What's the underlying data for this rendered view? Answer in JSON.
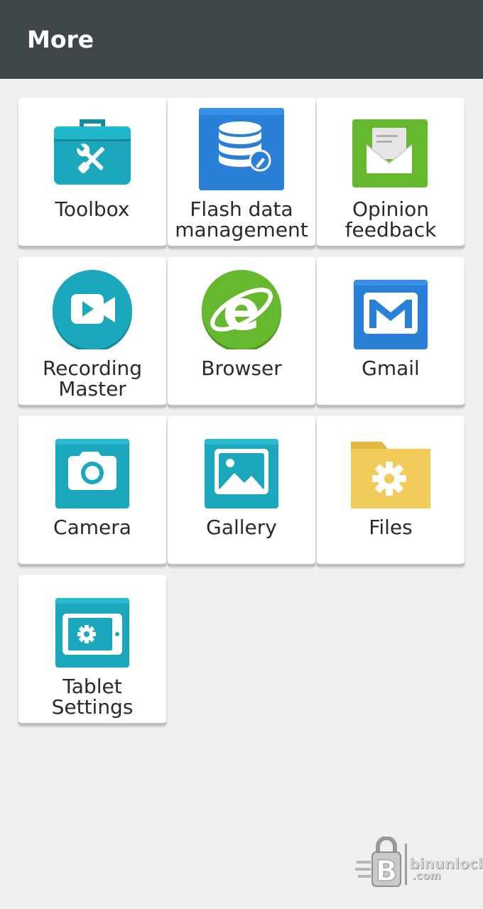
{
  "header": {
    "title": "More"
  },
  "apps": [
    {
      "id": "toolbox",
      "icon": "toolbox-icon",
      "line1": "Toolbox",
      "line2": ""
    },
    {
      "id": "flash-data-management",
      "icon": "database-icon",
      "line1": "Flash data",
      "line2": "management"
    },
    {
      "id": "opinion-feedback",
      "icon": "envelope-icon",
      "line1": "Opinion",
      "line2": "feedback"
    },
    {
      "id": "recording-master",
      "icon": "video-camera-icon",
      "line1": "Recording",
      "line2": "Master"
    },
    {
      "id": "browser",
      "icon": "browser-e-icon",
      "line1": "Browser",
      "line2": ""
    },
    {
      "id": "gmail",
      "icon": "gmail-icon",
      "line1": "Gmail",
      "line2": ""
    },
    {
      "id": "camera",
      "icon": "camera-icon",
      "line1": "Camera",
      "line2": ""
    },
    {
      "id": "gallery",
      "icon": "gallery-icon",
      "line1": "Gallery",
      "line2": ""
    },
    {
      "id": "files",
      "icon": "folder-gear-icon",
      "line1": "Files",
      "line2": ""
    },
    {
      "id": "tablet-settings",
      "icon": "tablet-settings-icon",
      "line1": "Tablet",
      "line2": "Settings"
    }
  ],
  "watermark": {
    "brand": "binunlock",
    "domain": ".com"
  },
  "colors": {
    "header_bg": "#3f4648",
    "teal": "#1ba8bd",
    "blue": "#2a7fd6",
    "green": "#66b82e",
    "folder": "#f2cc5a"
  }
}
